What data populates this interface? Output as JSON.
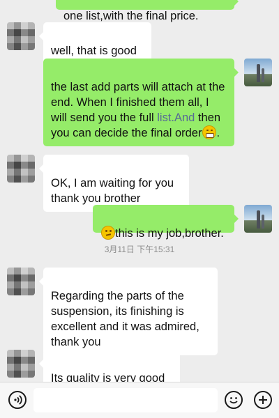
{
  "messages": [
    {
      "side": "out",
      "text": "one list,with the final price."
    },
    {
      "side": "in",
      "text": "well, that is good"
    },
    {
      "side": "out",
      "text_before_link": "the last add parts will attach at the end. When I finished them all, I will send you the full ",
      "link_text": "list.And",
      "text_after_link": " then you can decide the final order",
      "trailing_emoji": "grin-emoji"
    },
    {
      "side": "in",
      "text": "OK, I am waiting for you\nthank you brother"
    },
    {
      "side": "out",
      "leading_emoji": "thinking-emoji",
      "text": "this is my job,brother."
    },
    {
      "side": "in",
      "text": "Regarding the parts of the suspension, its finishing is excellent and it was admired, thank you"
    },
    {
      "side": "in",
      "text": "Its quality is very good"
    }
  ],
  "timestamp": "3月11日 下午15:31",
  "input_bar": {
    "placeholder": "",
    "icons": [
      "voice-icon",
      "emoji-icon",
      "add-icon"
    ]
  },
  "colors": {
    "background": "#ededed",
    "incoming_bubble": "#ffffff",
    "outgoing_bubble": "#95ec69",
    "link": "#576b95",
    "timestamp": "#8c8c8c"
  }
}
